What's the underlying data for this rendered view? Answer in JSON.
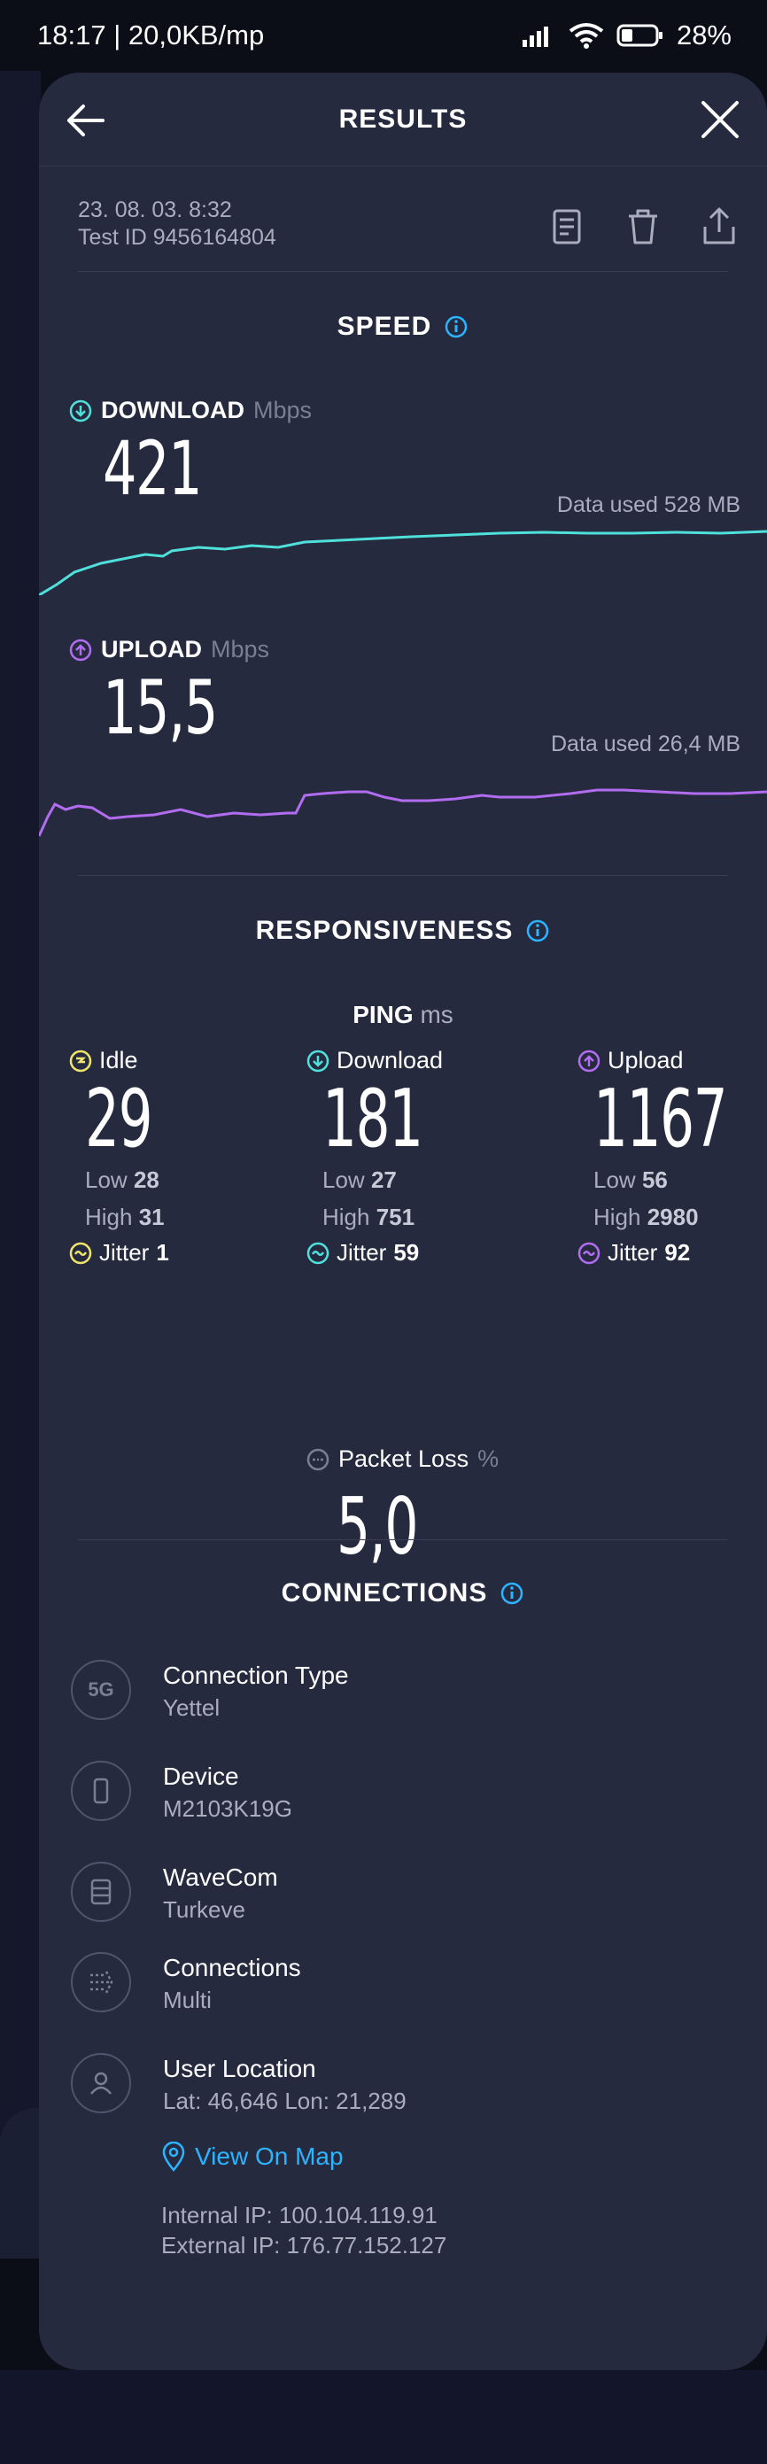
{
  "status_bar": {
    "time_speed": "18:17 | 20,0KB/mp",
    "battery": "28%"
  },
  "header": {
    "title": "RESULTS"
  },
  "meta": {
    "date": "23. 08. 03. 8:32",
    "test_id": "Test ID 9456164804"
  },
  "speed": {
    "title": "SPEED",
    "download": {
      "label": "DOWNLOAD",
      "unit": "Mbps",
      "value": "421",
      "data_used": "Data used 528 MB"
    },
    "upload": {
      "label": "UPLOAD",
      "unit": "Mbps",
      "value": "15,5",
      "data_used": "Data used 26,4 MB"
    }
  },
  "responsiveness": {
    "title": "RESPONSIVENESS",
    "ping_label": "PING",
    "ping_unit": "ms",
    "idle": {
      "label": "Idle",
      "value": "29",
      "low_label": "Low",
      "low": "28",
      "high_label": "High",
      "high": "31",
      "jitter_label": "Jitter",
      "jitter": "1"
    },
    "download": {
      "label": "Download",
      "value": "181",
      "low_label": "Low",
      "low": "27",
      "high_label": "High",
      "high": "751",
      "jitter_label": "Jitter",
      "jitter": "59"
    },
    "upload": {
      "label": "Upload",
      "value": "1167",
      "low_label": "Low",
      "low": "56",
      "high_label": "High",
      "high": "2980",
      "jitter_label": "Jitter",
      "jitter": "92"
    },
    "packet_loss": {
      "label": "Packet Loss",
      "unit": "%",
      "value": "5,0"
    }
  },
  "connections": {
    "title": "CONNECTIONS",
    "items": [
      {
        "title": "Connection Type",
        "value": "Yettel",
        "icon": "5g-icon",
        "icon_text": "5G"
      },
      {
        "title": "Device",
        "value": "M2103K19G",
        "icon": "phone-icon"
      },
      {
        "title": "WaveCom",
        "value": "Turkeve",
        "icon": "server-icon"
      },
      {
        "title": "Connections",
        "value": "Multi",
        "icon": "multi-connection-icon"
      },
      {
        "title": "User Location",
        "value": "Lat: 46,646 Lon: 21,289",
        "icon": "user-icon"
      }
    ],
    "map_link": "View On Map",
    "internal_ip": "Internal IP: 100.104.119.91",
    "external_ip": "External IP: 176.77.152.127"
  },
  "colors": {
    "download": "#4fe0dc",
    "upload": "#b26cf0",
    "idle": "#f0e46a",
    "link": "#2bb4ff",
    "info": "#2bb4ff"
  }
}
